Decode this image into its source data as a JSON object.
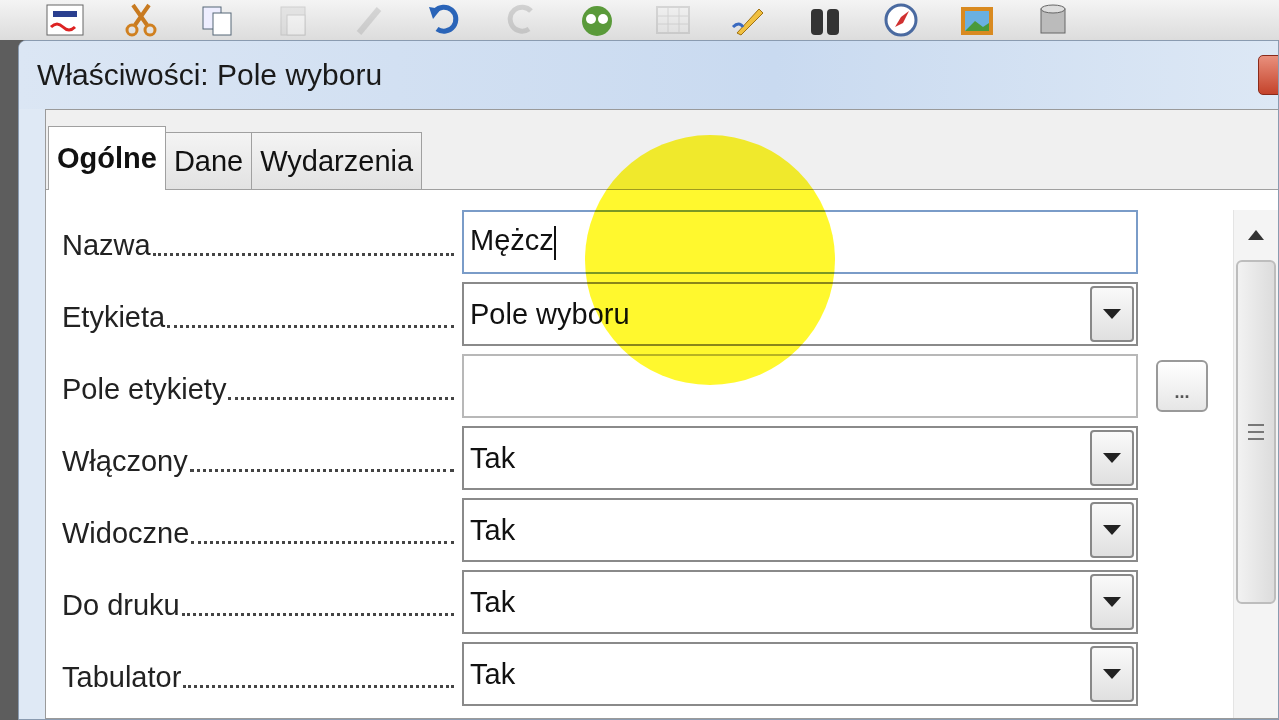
{
  "toolbar": {
    "buttons": [
      {
        "kind": "spellcheck",
        "disabled": false
      },
      {
        "kind": "cut",
        "disabled": false
      },
      {
        "kind": "copy",
        "disabled": false
      },
      {
        "kind": "paste",
        "disabled": true
      },
      {
        "kind": "brush",
        "disabled": true
      },
      {
        "kind": "undo",
        "disabled": false
      },
      {
        "kind": "redo",
        "disabled": true
      },
      {
        "kind": "navigator",
        "disabled": false
      },
      {
        "kind": "table",
        "disabled": true
      },
      {
        "kind": "draw",
        "disabled": false
      },
      {
        "kind": "find",
        "disabled": false
      },
      {
        "kind": "compass",
        "disabled": false
      },
      {
        "kind": "gallery",
        "disabled": false
      },
      {
        "kind": "database",
        "disabled": false
      }
    ]
  },
  "window": {
    "title": "Właściwości: Pole wyboru"
  },
  "tabs": [
    {
      "label": "Ogólne",
      "selected": true
    },
    {
      "label": "Dane",
      "selected": false
    },
    {
      "label": "Wydarzenia",
      "selected": false
    }
  ],
  "properties": [
    {
      "label": "Nazwa",
      "kind": "text",
      "value": "Mężcz",
      "focused": true
    },
    {
      "label": "Etykieta",
      "kind": "dropdown",
      "value": "Pole wyboru",
      "focused": false
    },
    {
      "label": "Pole etykiety",
      "kind": "text",
      "focused": false,
      "browse": "..."
    },
    {
      "label": "Włączony",
      "kind": "dropdown",
      "value": "Tak",
      "focused": false
    },
    {
      "label": "Widoczne",
      "kind": "dropdown",
      "value": "Tak",
      "focused": false
    },
    {
      "label": "Do druku",
      "kind": "dropdown",
      "value": "Tak",
      "focused": false
    },
    {
      "label": "Tabulator",
      "kind": "dropdown",
      "value": "Tak",
      "focused": false
    }
  ]
}
